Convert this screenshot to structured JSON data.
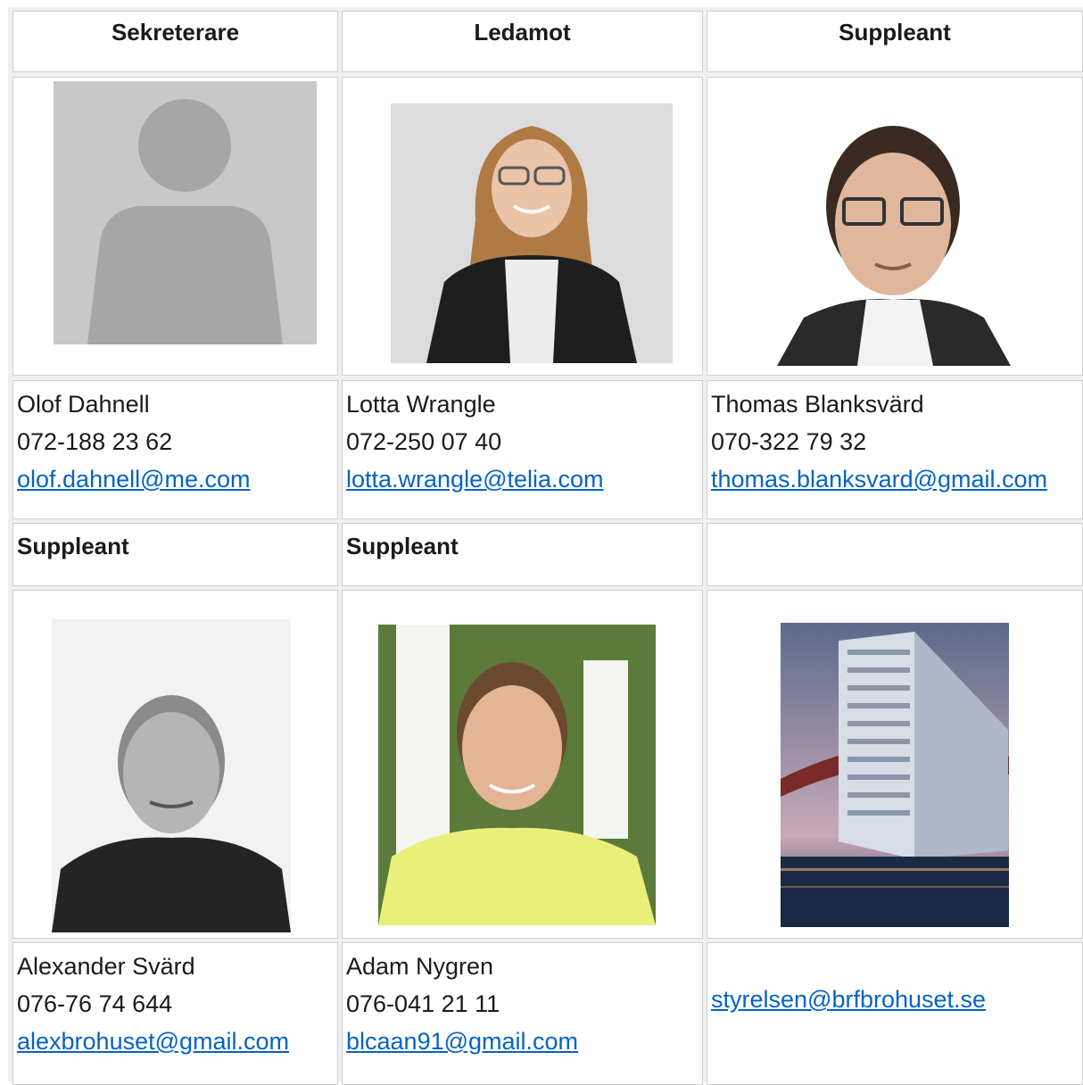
{
  "headers": {
    "col1": "Sekreterare",
    "col2": "Ledamot",
    "col3": "Suppleant"
  },
  "row2_headers": {
    "col1": "Suppleant",
    "col2": "Suppleant",
    "col3": ""
  },
  "members": [
    {
      "name": "Olof Dahnell",
      "phone": "072-188 23 62",
      "email": "olof.dahnell@me.com",
      "photo": "avatar-placeholder"
    },
    {
      "name": "Lotta Wrangle",
      "phone": "072-250 07 40",
      "email": "lotta.wrangle@telia.com",
      "photo": "portrait-woman"
    },
    {
      "name": "Thomas Blanksvärd",
      "phone": "070-322 79 32",
      "email": "thomas.blanksvard@gmail.com",
      "photo": "portrait-man-glasses"
    },
    {
      "name": "Alexander Svärd",
      "phone": "076-76 74 644",
      "email": "alexbrohuset@gmail.com",
      "photo": "portrait-man-bw"
    },
    {
      "name": "Adam Nygren",
      "phone": "076-041 21 11",
      "email": "blcaan91@gmail.com",
      "photo": "portrait-man-yellow-shirt"
    }
  ],
  "board_contact": {
    "email": "styrelsen@brfbrohuset.se",
    "photo": "building-brohuset"
  },
  "colors": {
    "link": "#0563c1",
    "border": "#cfcfcf",
    "background": "#ffffff"
  }
}
